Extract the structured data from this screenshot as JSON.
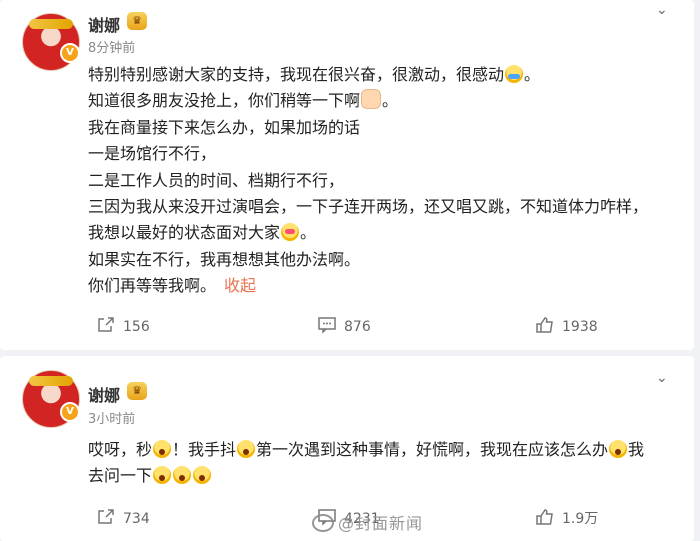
{
  "posts": [
    {
      "username": "谢娜",
      "crown": "♛",
      "time": "8分钟前",
      "lines": [
        [
          "特别特别感谢大家的支持，我现在很兴奋，很激动，很感动",
          "cry",
          "。"
        ],
        [
          "知道很多朋友没抢上，你们稍等一下啊",
          "fist",
          "。"
        ],
        [
          "我在商量接下来怎么办，如果加场的话"
        ],
        [
          "一是场馆行不行，"
        ],
        [
          "二是工作人员的时间、档期行不行，"
        ],
        [
          "三因为我从来没开过演唱会，一下子连开两场，还又唱又跳，不知道体力咋样，"
        ],
        [
          "我想以最好的状态面对大家",
          "heart",
          "。"
        ],
        [
          "如果实在不行，我再想想其他办法啊。"
        ],
        [
          "你们再等等我啊。"
        ]
      ],
      "collapse_label": "收起",
      "repost_count": "156",
      "comment_count": "876",
      "like_count": "1938"
    },
    {
      "username": "谢娜",
      "crown": "♛",
      "time": "3小时前",
      "line1_a": "哎呀，秒",
      "line1_b": "！我手抖",
      "line1_c": "第一次遇到这种事情，好慌啊，我现在应该怎么办",
      "line1_d": "我",
      "line2": "去问一下",
      "repost_count": "734",
      "comment_count": "4231",
      "like_count": "1.9万"
    }
  ],
  "watermark": "@封面新闻",
  "colors": {
    "accent": "#eb7350",
    "vip": "#f7a21b"
  }
}
